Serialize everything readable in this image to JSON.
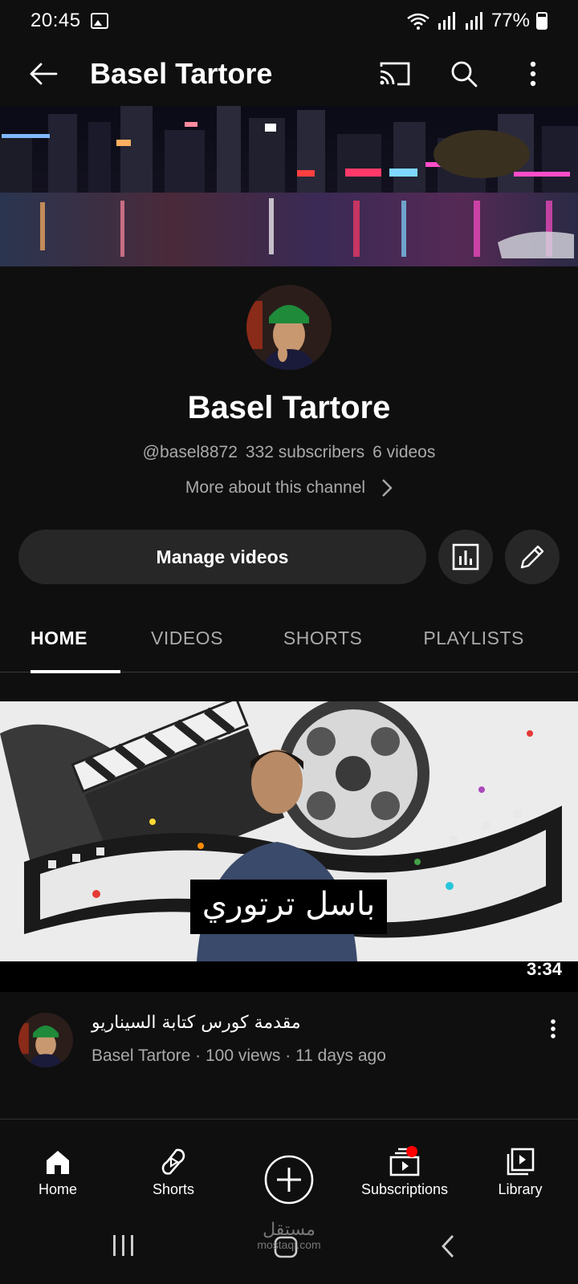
{
  "status_bar": {
    "time": "20:45",
    "battery": "77%",
    "icons": [
      "image-icon",
      "wifi-icon",
      "signal-icon",
      "battery-icon"
    ]
  },
  "app_bar": {
    "title": "Basel Tartore",
    "icons": [
      "back-arrow-icon",
      "cast-icon",
      "search-icon",
      "more-vert-icon"
    ]
  },
  "channel": {
    "name": "Basel Tartore",
    "handle": "@basel8872",
    "subscribers": "332 subscribers",
    "videos": "6 videos",
    "more_about": "More about this channel"
  },
  "actions": {
    "manage_videos": "Manage videos",
    "icons": [
      "analytics-icon",
      "edit-pencil-icon"
    ]
  },
  "tabs": [
    {
      "label": "HOME",
      "active": true
    },
    {
      "label": "VIDEOS",
      "active": false
    },
    {
      "label": "SHORTS",
      "active": false
    },
    {
      "label": "PLAYLISTS",
      "active": false
    }
  ],
  "featured_video": {
    "thumbnail_caption": "باسل ترتوري",
    "duration": "3:34",
    "title": "مقدمة كورس كتابة السيناريو",
    "meta": "Basel Tartore · 100 views · 11 days ago"
  },
  "bottom_nav": [
    {
      "label": "Home",
      "icon": "home-icon"
    },
    {
      "label": "Shorts",
      "icon": "shorts-icon"
    },
    {
      "label": "",
      "icon": "create-plus-icon"
    },
    {
      "label": "Subscriptions",
      "icon": "subscriptions-icon",
      "badge": true
    },
    {
      "label": "Library",
      "icon": "library-icon"
    }
  ],
  "watermark": {
    "arabic": "مستقل",
    "latin": "mostaql.com"
  },
  "colors": {
    "background": "#0f0f0f",
    "surface": "#272727",
    "text_secondary": "#aaaaaa",
    "badge_red": "#ff0000"
  }
}
